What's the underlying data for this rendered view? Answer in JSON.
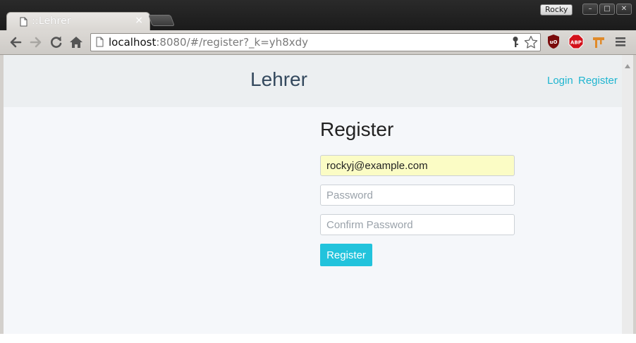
{
  "window": {
    "user_badge": "Rocky",
    "buttons": [
      "–",
      "□",
      "✕"
    ]
  },
  "tab": {
    "title": "::Lehrer",
    "close": "×",
    "icon": "page-icon"
  },
  "toolbar": {
    "url_host": "localhost",
    "url_rest": ":8080/#/register?_k=yh8xdy",
    "icons": [
      "back-icon",
      "forward-icon",
      "reload-icon",
      "home-icon",
      "key-icon",
      "star-icon",
      "ublock-icon",
      "adblock-plus-icon",
      "extension-icon",
      "menu-icon"
    ]
  },
  "site": {
    "brand": "Lehrer",
    "nav": {
      "login": "Login",
      "register": "Register"
    },
    "link_color": "#1fb5d0"
  },
  "form": {
    "title": "Register",
    "email_value": "rockyj@example.com",
    "password_placeholder": "Password",
    "confirm_placeholder": "Confirm Password",
    "submit_label": "Register",
    "accent": "#22c3dc"
  }
}
